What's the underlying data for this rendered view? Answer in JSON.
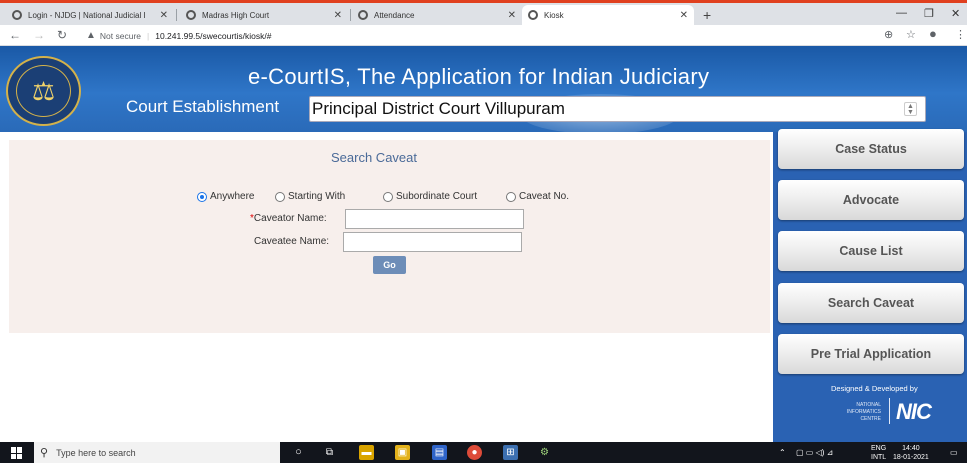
{
  "browser": {
    "tabs": [
      {
        "title": "Login - NJDG | National Judicial I",
        "active": false
      },
      {
        "title": "Madras High Court",
        "active": false
      },
      {
        "title": "Attendance",
        "active": false
      },
      {
        "title": "Kiosk",
        "active": true
      }
    ],
    "security": "Not secure",
    "url": "10.241.99.5/swecourtis/kiosk/#"
  },
  "header": {
    "app_title": "e-CourtIS, The Application for Indian Judiciary",
    "establishment_label": "Court Establishment",
    "establishment_value": "Principal District Court Villupuram"
  },
  "search": {
    "title": "Search Caveat",
    "radio_options": [
      {
        "label": "Anywhere",
        "checked": true
      },
      {
        "label": "Starting With",
        "checked": false
      },
      {
        "label": "Subordinate Court",
        "checked": false
      },
      {
        "label": "Caveat No.",
        "checked": false
      }
    ],
    "caveator_required_mark": "*",
    "caveator_label": "Caveator Name:",
    "caveatee_label": "Caveatee Name:",
    "go_label": "Go"
  },
  "sidebar": {
    "items": [
      {
        "label": "Case Status"
      },
      {
        "label": "Advocate"
      },
      {
        "label": "Cause List"
      },
      {
        "label": "Search Caveat"
      },
      {
        "label": "Pre Trial Application"
      }
    ],
    "credit": "Designed & Developed by",
    "nic_lines": [
      "NATIONAL",
      "INFORMATICS",
      "CENTRE"
    ],
    "nic_logo": "NIC"
  },
  "taskbar": {
    "search_placeholder": "Type here to search",
    "lang_top": "ENG",
    "lang_bottom": "INTL",
    "time": "14:40",
    "date": "18-01-2021"
  }
}
